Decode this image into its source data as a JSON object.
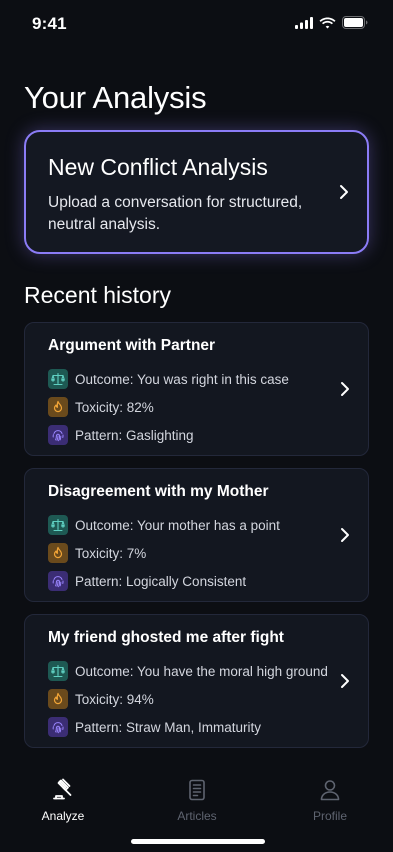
{
  "status": {
    "time": "9:41"
  },
  "page_title": "Your Analysis",
  "new_analysis": {
    "title": "New Conflict Analysis",
    "description": "Upload a conversation for structured, neutral analysis."
  },
  "recent_title": "Recent history",
  "history": [
    {
      "title": "Argument with Partner",
      "outcome": "Outcome: You was right in this case",
      "toxicity": "Toxicity: 82%",
      "pattern": "Pattern: Gaslighting"
    },
    {
      "title": "Disagreement with my Mother",
      "outcome": "Outcome: Your mother has a point",
      "toxicity": "Toxicity: 7%",
      "pattern": "Pattern: Logically Consistent"
    },
    {
      "title": "My friend ghosted me after fight",
      "outcome": "Outcome: You have the moral high ground",
      "toxicity": "Toxicity: 94%",
      "pattern": "Pattern: Straw Man, Immaturity"
    }
  ],
  "tabs": [
    {
      "label": "Analyze",
      "icon": "gavel-icon",
      "active": true
    },
    {
      "label": "Articles",
      "icon": "document-icon",
      "active": false
    },
    {
      "label": "Profile",
      "icon": "person-icon",
      "active": false
    }
  ],
  "colors": {
    "accent": "#8b7cf6",
    "background": "#0c0e13",
    "card": "#131720",
    "outcome_icon": "#5fd0c2",
    "toxicity_icon": "#f0a437",
    "pattern_icon": "#9b86ff"
  }
}
